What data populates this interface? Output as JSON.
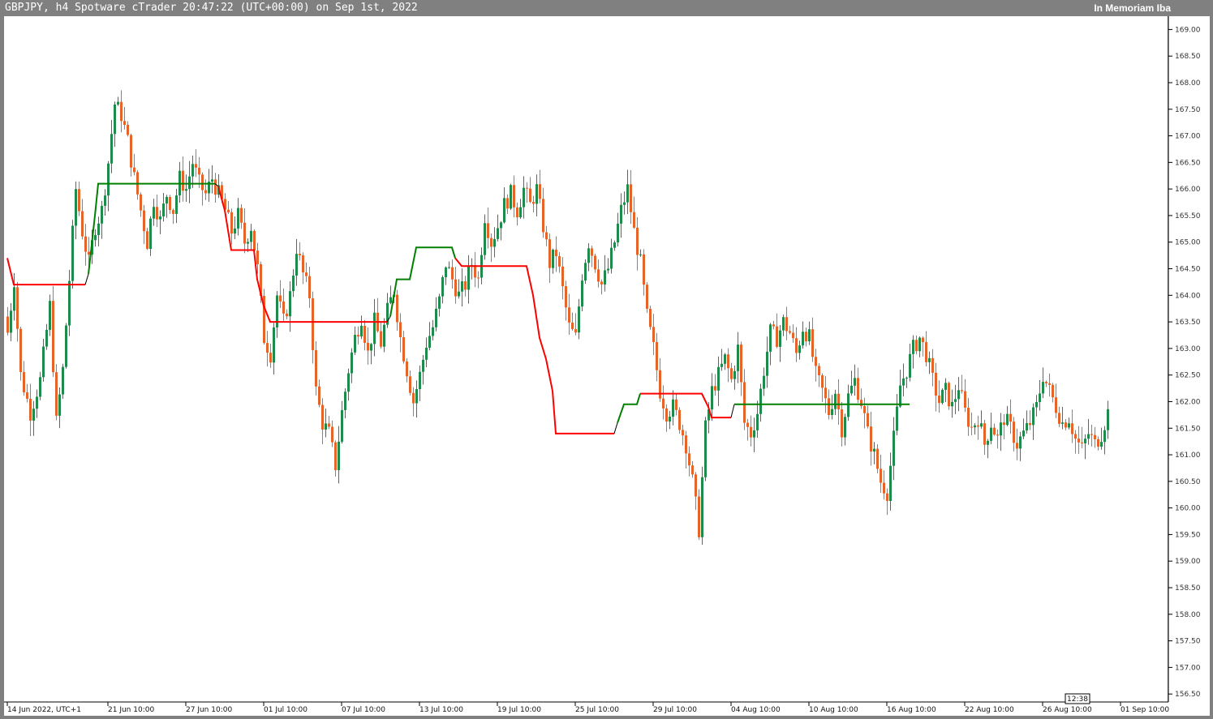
{
  "header": {
    "title": "GBPJPY, h4 Spotware cTrader 20:47:22 (UTC+00:00) on Sep 1st, 2022",
    "right_label": "In Memoriam Iba"
  },
  "colors": {
    "frame": "#808080",
    "plot_bg": "#ffffff",
    "bull": "#1e8a4c",
    "bear": "#e8632a",
    "trend_up": "#008000",
    "trend_down": "#ff0000",
    "transition": "#000000"
  },
  "chart_data": {
    "type": "candlestick",
    "symbol": "GBPJPY",
    "timeframe": "h4",
    "ylim": [
      156.35,
      169.25
    ],
    "y_ticks": [
      {
        "value": 169.0,
        "label": "169.00"
      },
      {
        "value": 168.5,
        "label": "168.50"
      },
      {
        "value": 168.0,
        "label": "168.00"
      },
      {
        "value": 167.5,
        "label": "167.50"
      },
      {
        "value": 167.0,
        "label": "167.00"
      },
      {
        "value": 166.5,
        "label": "166.50"
      },
      {
        "value": 166.0,
        "label": "166.00"
      },
      {
        "value": 165.5,
        "label": "165.50"
      },
      {
        "value": 165.0,
        "label": "165.00"
      },
      {
        "value": 164.5,
        "label": "164.50"
      },
      {
        "value": 164.0,
        "label": "164.00"
      },
      {
        "value": 163.5,
        "label": "163.50"
      },
      {
        "value": 163.0,
        "label": "163.00"
      },
      {
        "value": 162.5,
        "label": "162.50"
      },
      {
        "value": 162.0,
        "label": "162.00"
      },
      {
        "value": 161.5,
        "label": "161.50"
      },
      {
        "value": 161.0,
        "label": "161.00"
      },
      {
        "value": 160.5,
        "label": "160.50"
      },
      {
        "value": 160.0,
        "label": "160.00"
      },
      {
        "value": 159.5,
        "label": "159.50"
      },
      {
        "value": 159.0,
        "label": "159.00"
      },
      {
        "value": 158.5,
        "label": "158.50"
      },
      {
        "value": 158.0,
        "label": "158.00"
      },
      {
        "value": 157.5,
        "label": "157.50"
      },
      {
        "value": 157.0,
        "label": "157.00"
      },
      {
        "value": 156.5,
        "label": "156.50"
      }
    ],
    "x_ticks": [
      {
        "bar": 0,
        "label": "14 Jun 2022, UTC+1"
      },
      {
        "bar": 31,
        "label": "21 Jun 10:00"
      },
      {
        "bar": 55,
        "label": "27 Jun 10:00"
      },
      {
        "bar": 79,
        "label": "01 Jul 10:00"
      },
      {
        "bar": 103,
        "label": "07 Jul 10:00"
      },
      {
        "bar": 127,
        "label": "13 Jul 10:00"
      },
      {
        "bar": 151,
        "label": "19 Jul 10:00"
      },
      {
        "bar": 175,
        "label": "25 Jul 10:00"
      },
      {
        "bar": 199,
        "label": "29 Jul 10:00"
      },
      {
        "bar": 223,
        "label": "04 Aug 10:00"
      },
      {
        "bar": 247,
        "label": "10 Aug 10:00"
      },
      {
        "bar": 271,
        "label": "16 Aug 10:00"
      },
      {
        "bar": 295,
        "label": "22 Aug 10:00"
      },
      {
        "bar": 319,
        "label": "26 Aug 10:00"
      },
      {
        "bar": 343,
        "label": "01 Sep 10:00"
      }
    ],
    "time_box": "12:38",
    "close_path": [
      [
        0,
        163.3
      ],
      [
        2,
        164.3
      ],
      [
        4,
        162.5
      ],
      [
        7,
        161.8
      ],
      [
        10,
        162.4
      ],
      [
        13,
        163.8
      ],
      [
        15,
        161.6
      ],
      [
        17,
        162.6
      ],
      [
        19,
        164.3
      ],
      [
        21,
        166.0
      ],
      [
        23,
        165.2
      ],
      [
        25,
        164.6
      ],
      [
        27,
        165.3
      ],
      [
        29,
        165.6
      ],
      [
        31,
        166.5
      ],
      [
        33,
        167.6
      ],
      [
        35,
        167.4
      ],
      [
        37,
        166.9
      ],
      [
        39,
        166.2
      ],
      [
        41,
        165.6
      ],
      [
        43,
        165.0
      ],
      [
        45,
        165.8
      ],
      [
        47,
        165.4
      ],
      [
        49,
        165.9
      ],
      [
        51,
        165.6
      ],
      [
        53,
        166.2
      ],
      [
        55,
        166.0
      ],
      [
        57,
        166.5
      ],
      [
        59,
        166.1
      ],
      [
        61,
        165.9
      ],
      [
        63,
        166.2
      ],
      [
        65,
        165.9
      ],
      [
        67,
        165.6
      ],
      [
        69,
        165.2
      ],
      [
        71,
        165.5
      ],
      [
        73,
        165.0
      ],
      [
        75,
        165.3
      ],
      [
        77,
        164.5
      ],
      [
        79,
        163.2
      ],
      [
        81,
        162.9
      ],
      [
        83,
        164.0
      ],
      [
        85,
        163.5
      ],
      [
        87,
        164.0
      ],
      [
        89,
        164.9
      ],
      [
        91,
        164.4
      ],
      [
        93,
        164.0
      ],
      [
        95,
        162.2
      ],
      [
        97,
        161.6
      ],
      [
        99,
        161.4
      ],
      [
        101,
        160.8
      ],
      [
        103,
        161.8
      ],
      [
        105,
        162.6
      ],
      [
        107,
        163.2
      ],
      [
        109,
        163.6
      ],
      [
        111,
        162.9
      ],
      [
        113,
        163.5
      ],
      [
        115,
        163.1
      ],
      [
        117,
        163.7
      ],
      [
        119,
        164.1
      ],
      [
        121,
        163.2
      ],
      [
        123,
        162.6
      ],
      [
        125,
        162.0
      ],
      [
        127,
        162.5
      ],
      [
        129,
        163.1
      ],
      [
        131,
        163.4
      ],
      [
        133,
        163.9
      ],
      [
        135,
        164.6
      ],
      [
        137,
        164.3
      ],
      [
        139,
        164.0
      ],
      [
        141,
        164.2
      ],
      [
        143,
        164.6
      ],
      [
        145,
        164.3
      ],
      [
        147,
        165.5
      ],
      [
        149,
        165.0
      ],
      [
        151,
        165.3
      ],
      [
        153,
        165.7
      ],
      [
        155,
        165.9
      ],
      [
        157,
        165.6
      ],
      [
        159,
        166.0
      ],
      [
        161,
        165.7
      ],
      [
        163,
        166.0
      ],
      [
        165,
        165.3
      ],
      [
        167,
        164.6
      ],
      [
        169,
        164.8
      ],
      [
        171,
        164.1
      ],
      [
        173,
        163.4
      ],
      [
        175,
        163.2
      ],
      [
        177,
        164.4
      ],
      [
        179,
        165.0
      ],
      [
        181,
        164.6
      ],
      [
        183,
        164.2
      ],
      [
        185,
        164.5
      ],
      [
        187,
        165.0
      ],
      [
        189,
        165.6
      ],
      [
        191,
        166.0
      ],
      [
        193,
        165.2
      ],
      [
        195,
        164.6
      ],
      [
        197,
        163.6
      ],
      [
        199,
        163.0
      ],
      [
        201,
        162.2
      ],
      [
        203,
        161.8
      ],
      [
        205,
        161.9
      ],
      [
        207,
        161.6
      ],
      [
        209,
        161.2
      ],
      [
        211,
        160.5
      ],
      [
        213,
        159.6
      ],
      [
        215,
        161.5
      ],
      [
        217,
        162.2
      ],
      [
        219,
        162.5
      ],
      [
        221,
        162.8
      ],
      [
        223,
        162.4
      ],
      [
        225,
        163.0
      ],
      [
        227,
        161.6
      ],
      [
        229,
        161.4
      ],
      [
        231,
        161.8
      ],
      [
        233,
        162.6
      ],
      [
        235,
        163.3
      ],
      [
        237,
        163.2
      ],
      [
        239,
        163.5
      ],
      [
        241,
        163.3
      ],
      [
        243,
        162.9
      ],
      [
        245,
        163.4
      ],
      [
        247,
        163.2
      ],
      [
        249,
        162.5
      ],
      [
        251,
        162.2
      ],
      [
        253,
        161.8
      ],
      [
        255,
        162.2
      ],
      [
        257,
        161.5
      ],
      [
        259,
        162.1
      ],
      [
        261,
        162.4
      ],
      [
        263,
        162.0
      ],
      [
        265,
        161.4
      ],
      [
        267,
        161.0
      ],
      [
        269,
        160.5
      ],
      [
        271,
        160.3
      ],
      [
        273,
        161.3
      ],
      [
        275,
        162.3
      ],
      [
        277,
        162.6
      ],
      [
        279,
        163.0
      ],
      [
        281,
        163.2
      ],
      [
        283,
        162.9
      ],
      [
        285,
        162.4
      ],
      [
        287,
        162.0
      ],
      [
        289,
        162.2
      ],
      [
        291,
        161.9
      ],
      [
        293,
        162.3
      ],
      [
        295,
        161.8
      ],
      [
        297,
        161.5
      ],
      [
        299,
        161.7
      ],
      [
        301,
        161.2
      ],
      [
        303,
        161.6
      ],
      [
        305,
        161.3
      ],
      [
        307,
        161.7
      ],
      [
        309,
        161.5
      ],
      [
        311,
        161.2
      ],
      [
        313,
        161.4
      ],
      [
        315,
        161.6
      ],
      [
        317,
        161.9
      ],
      [
        319,
        162.5
      ],
      [
        321,
        162.2
      ],
      [
        323,
        161.9
      ],
      [
        325,
        161.6
      ],
      [
        327,
        161.7
      ],
      [
        329,
        161.3
      ],
      [
        331,
        161.1
      ],
      [
        333,
        161.4
      ],
      [
        335,
        161.2
      ],
      [
        337,
        161.4
      ],
      [
        339,
        161.8
      ]
    ],
    "trend_series": [
      {
        "name": "",
        "points": [
          [
            0,
            164.7
          ],
          [
            2,
            164.2
          ],
          [
            24,
            164.2
          ]
        ]
      },
      {
        "name": "",
        "points": [
          [
            25,
            164.4
          ],
          [
            27,
            165.5
          ],
          [
            28,
            166.1
          ],
          [
            64,
            166.1
          ]
        ]
      },
      {
        "name": "",
        "points": [
          [
            65,
            166.05
          ],
          [
            67,
            165.6
          ],
          [
            69,
            164.85
          ],
          [
            76,
            164.85
          ],
          [
            77,
            164.3
          ],
          [
            79,
            163.8
          ],
          [
            81,
            163.5
          ],
          [
            117,
            163.5
          ]
        ]
      },
      {
        "name": "",
        "points": [
          [
            118,
            163.6
          ],
          [
            120,
            164.3
          ],
          [
            124,
            164.3
          ],
          [
            126,
            164.9
          ],
          [
            137,
            164.9
          ],
          [
            138,
            164.7
          ],
          [
            140,
            164.55
          ],
          [
            160,
            164.55
          ],
          [
            162,
            164.0
          ],
          [
            164,
            163.2
          ],
          [
            166,
            162.8
          ],
          [
            168,
            162.2
          ],
          [
            169,
            161.4
          ],
          [
            187,
            161.4
          ]
        ]
      },
      {
        "name": "",
        "points": [
          [
            188,
            161.6
          ],
          [
            190,
            161.95
          ],
          [
            194,
            161.95
          ],
          [
            195,
            162.15
          ],
          [
            214,
            162.15
          ],
          [
            216,
            161.9
          ],
          [
            217,
            161.7
          ],
          [
            223,
            161.7
          ]
        ]
      },
      {
        "name": "",
        "points": [
          [
            224,
            161.95
          ],
          [
            278,
            161.95
          ]
        ]
      }
    ]
  }
}
